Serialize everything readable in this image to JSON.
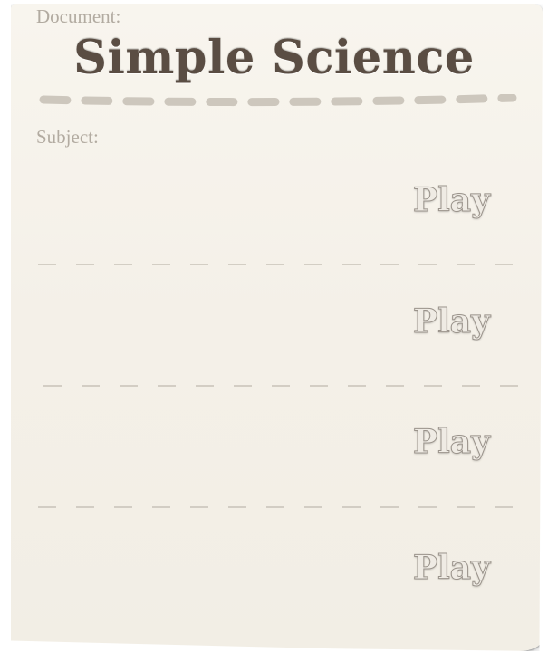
{
  "document": {
    "label": "Document:",
    "title": "Simple Science"
  },
  "subject": {
    "label": "Subject:"
  },
  "rows": [
    {
      "play_label": "Play"
    },
    {
      "play_label": "Play"
    },
    {
      "play_label": "Play"
    },
    {
      "play_label": "Play"
    }
  ],
  "colors": {
    "paper": "#f4f0e8",
    "title": "#5a4d43",
    "label": "#b2aba1",
    "rule": "#c8c2b8"
  }
}
